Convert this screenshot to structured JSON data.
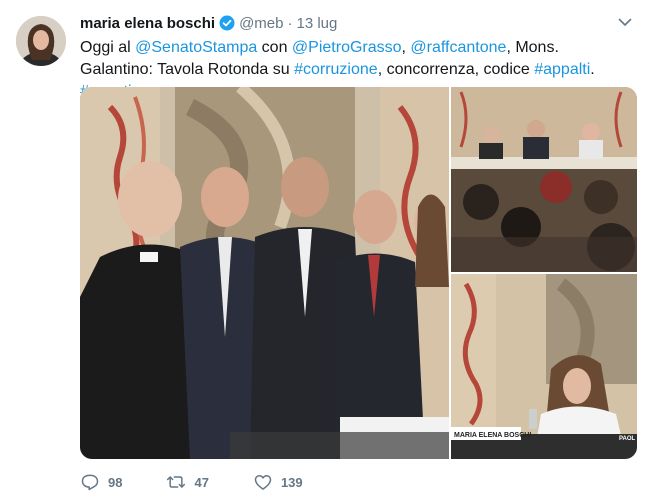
{
  "tweet": {
    "author_name": "maria elena boschi",
    "handle": "@meb",
    "separator": "·",
    "date": "13 lug",
    "text_segments": [
      {
        "text": "Oggi al ",
        "type": "plain"
      },
      {
        "text": "@SenatoStampa",
        "type": "link"
      },
      {
        "text": " con ",
        "type": "plain"
      },
      {
        "text": "@PietroGrasso",
        "type": "link"
      },
      {
        "text": ", ",
        "type": "plain"
      },
      {
        "text": "@raffcantone",
        "type": "link"
      },
      {
        "text": ", Mons. Galantino: Tavola Rotonda su ",
        "type": "plain"
      },
      {
        "text": "#corruzione",
        "type": "link"
      },
      {
        "text": ", concorrenza, codice ",
        "type": "plain"
      },
      {
        "text": "#appalti",
        "type": "link"
      },
      {
        "text": ". ",
        "type": "plain"
      },
      {
        "text": "#avanti",
        "type": "link"
      }
    ],
    "media_captions": {
      "nameplate": "MARIA ELENA BOSCHI",
      "corner_text": "PAOL"
    },
    "replies": "98",
    "retweets": "47",
    "likes": "139"
  },
  "colors": {
    "link": "#1b95e0",
    "secondary": "#657786",
    "verified": "#1da1f2"
  },
  "icons": [
    "verified-badge-icon",
    "chevron-down-icon",
    "reply-icon",
    "retweet-icon",
    "like-icon"
  ]
}
